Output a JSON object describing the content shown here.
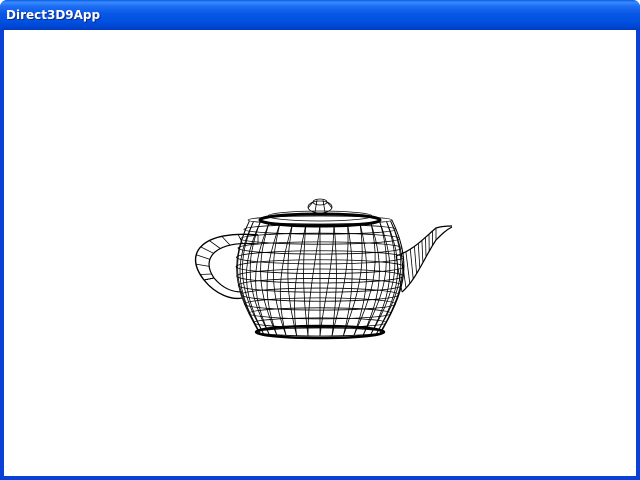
{
  "window": {
    "title": "Direct3D9App"
  },
  "scene": {
    "object": "teapot",
    "render_mode": "wireframe",
    "background_color": "#ffffff",
    "wire_color": "#000000"
  }
}
